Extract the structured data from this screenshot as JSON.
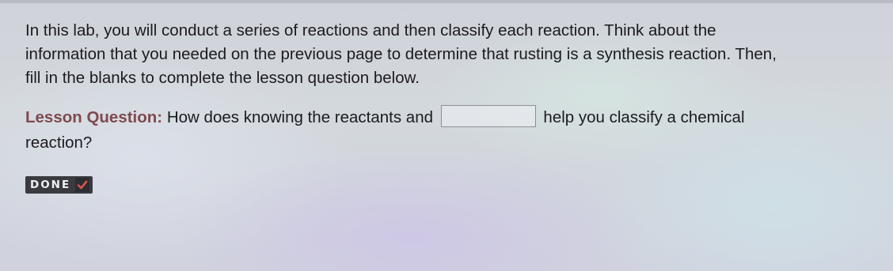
{
  "intro": {
    "line1": "In this lab, you will conduct a series of reactions and then classify each reaction. Think about the",
    "line2": "information that you needed on the previous page to determine that rusting is a synthesis reaction. Then,",
    "line3": "fill in the blanks to complete the lesson question below."
  },
  "question": {
    "label": "Lesson Question:",
    "text_before": " How does knowing the reactants and ",
    "blank_value": "",
    "text_after": " help you classify a chemical",
    "text_line2": "reaction?"
  },
  "done_button": {
    "label": "DONE",
    "icon": "checkmark-icon",
    "check_color": "#d9534f"
  }
}
